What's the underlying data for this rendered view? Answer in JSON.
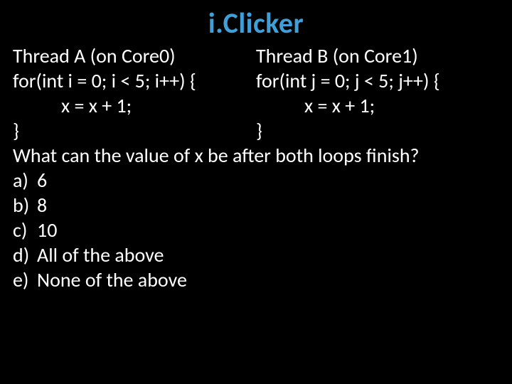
{
  "title": "i.Clicker",
  "threadA": {
    "header": "Thread A (on Core0)",
    "for": "for(int i = 0; i < 5; i++) {",
    "stmt": "x = x + 1;",
    "close": "}"
  },
  "threadB": {
    "header": "Thread B (on Core1)",
    "for": "for(int j = 0; j < 5; j++) {",
    "stmt": "x = x + 1;",
    "close": "}"
  },
  "question": "What can the value of x be after both loops finish?",
  "options": [
    {
      "letter": "a)",
      "text": "6"
    },
    {
      "letter": "b)",
      "text": "8"
    },
    {
      "letter": "c)",
      "text": "10"
    },
    {
      "letter": "d)",
      "text": "All of the above"
    },
    {
      "letter": "e)",
      "text": "None of the above"
    }
  ]
}
